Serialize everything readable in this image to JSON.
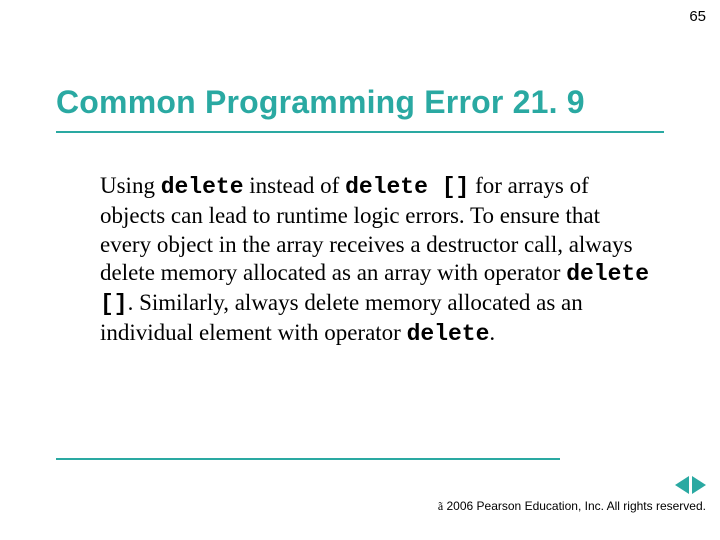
{
  "page_number": "65",
  "title": "Common Programming Error 21. 9",
  "body": {
    "t1": "Using ",
    "c1": "delete",
    "t2": " instead of ",
    "c2": "delete []",
    "t3": " for arrays of objects can lead to runtime logic errors. To ensure that every object in the array receives a destructor call, always delete memory allocated as an array with operator ",
    "c3": "delete []",
    "t4": ". Similarly, always delete memory allocated as an individual element with operator ",
    "c4": "delete",
    "t5": "."
  },
  "footer": {
    "symbol": "ã",
    "text": " 2006 Pearson Education, Inc.  All rights reserved."
  },
  "colors": {
    "accent": "#2aa9a2"
  }
}
